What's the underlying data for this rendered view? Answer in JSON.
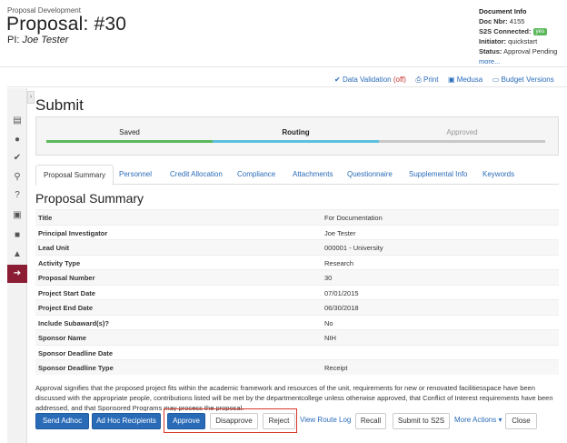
{
  "header": {
    "app_name": "Proposal Development",
    "title": "Proposal: #30",
    "pi_label": "PI:",
    "pi_name": "Joe Tester"
  },
  "doc_info": {
    "heading": "Document Info",
    "doc_nbr_label": "Doc Nbr:",
    "doc_nbr": "4155",
    "s2s_label": "S2S Connected:",
    "s2s_value": "yes",
    "initiator_label": "Initiator:",
    "initiator": "quickstart",
    "status_label": "Status:",
    "status": "Approval Pending",
    "more_link": "more..."
  },
  "toolbar": {
    "data_validation": "Data Validation",
    "data_validation_state": "(off)",
    "print": "Print",
    "medusa": "Medusa",
    "budget_versions": "Budget Versions"
  },
  "page_title": "Submit",
  "route": {
    "stages": [
      "Saved",
      "Routing",
      "Approved"
    ],
    "colors": [
      "#5cb85c",
      "#5bc0de",
      "#c8c8c8"
    ]
  },
  "tabs": [
    "Proposal Summary",
    "Personnel",
    "Credit Allocation",
    "Compliance",
    "Attachments",
    "Questionnaire",
    "Supplemental Info",
    "Keywords"
  ],
  "section_title": "Proposal Summary",
  "summary_rows": [
    {
      "label": "Title",
      "value": "For Documentation"
    },
    {
      "label": "Principal Investigator",
      "value": "Joe Tester"
    },
    {
      "label": "Lead Unit",
      "value": "000001 - University"
    },
    {
      "label": "Activity Type",
      "value": "Research"
    },
    {
      "label": "Proposal Number",
      "value": "30"
    },
    {
      "label": "Project Start Date",
      "value": "07/01/2015"
    },
    {
      "label": "Project End Date",
      "value": "06/30/2018"
    },
    {
      "label": "Include Subaward(s)?",
      "value": "No"
    },
    {
      "label": "Sponsor Name",
      "value": "NIH"
    },
    {
      "label": "Sponsor Deadline Date",
      "value": ""
    },
    {
      "label": "Sponsor Deadline Type",
      "value": "Receipt"
    }
  ],
  "certification_text": "Approval signifies that the proposed project fits within the academic framework and resources of the unit, requirements for new or renovated facilitiesspace have been discussed with the appropriate people, contributions listed will be met by the departmentcollege unless otherwise approved, that Conflict of Interest requirements have been addressed, and that Sponsored Programs may process the proposal.",
  "actions": {
    "send_adhoc": "Send Adhoc",
    "ad_hoc_recipients": "Ad Hoc Recipients",
    "approve": "Approve",
    "disapprove": "Disapprove",
    "reject": "Reject",
    "view_route_log": "View Route Log",
    "recall": "Recall",
    "submit_to_s2s": "Submit to S2S",
    "more_actions": "More Actions",
    "close": "Close"
  },
  "colors": {
    "link": "#2a6bb8",
    "primary_button": "#2a6bb8",
    "rail_active": "#8b1d35",
    "highlight_box": "#d9362b",
    "off_state": "#c9302c"
  }
}
